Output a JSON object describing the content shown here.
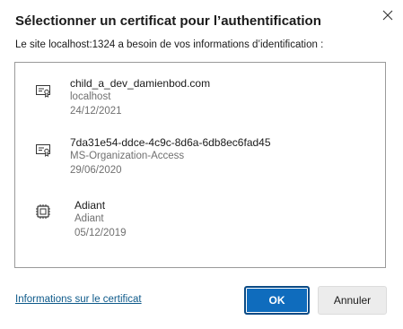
{
  "dialog": {
    "title": "Sélectionner un certificat pour l’authentification",
    "subtitle": "Le site localhost:1324 a besoin de vos informations d’identification :",
    "close_icon": "close-icon"
  },
  "certificates": [
    {
      "name": "child_a_dev_damienbod.com",
      "issuer": "localhost",
      "date": "24/12/2021",
      "icon": "certificate-icon"
    },
    {
      "name": "7da31e54-ddce-4c9c-8d6a-6db8ec6fad45",
      "issuer": "MS-Organization-Access",
      "date": "29/06/2020",
      "icon": "certificate-icon"
    },
    {
      "name": "Adiant",
      "issuer": "Adiant",
      "date": "05/12/2019",
      "icon": "smartcard-chip-icon"
    }
  ],
  "footer": {
    "info_link": "Informations sur le certificat",
    "ok_label": "OK",
    "cancel_label": "Annuler"
  },
  "colors": {
    "accent": "#0f6cbd",
    "link": "#0e5a8a",
    "muted_text": "#707070"
  }
}
